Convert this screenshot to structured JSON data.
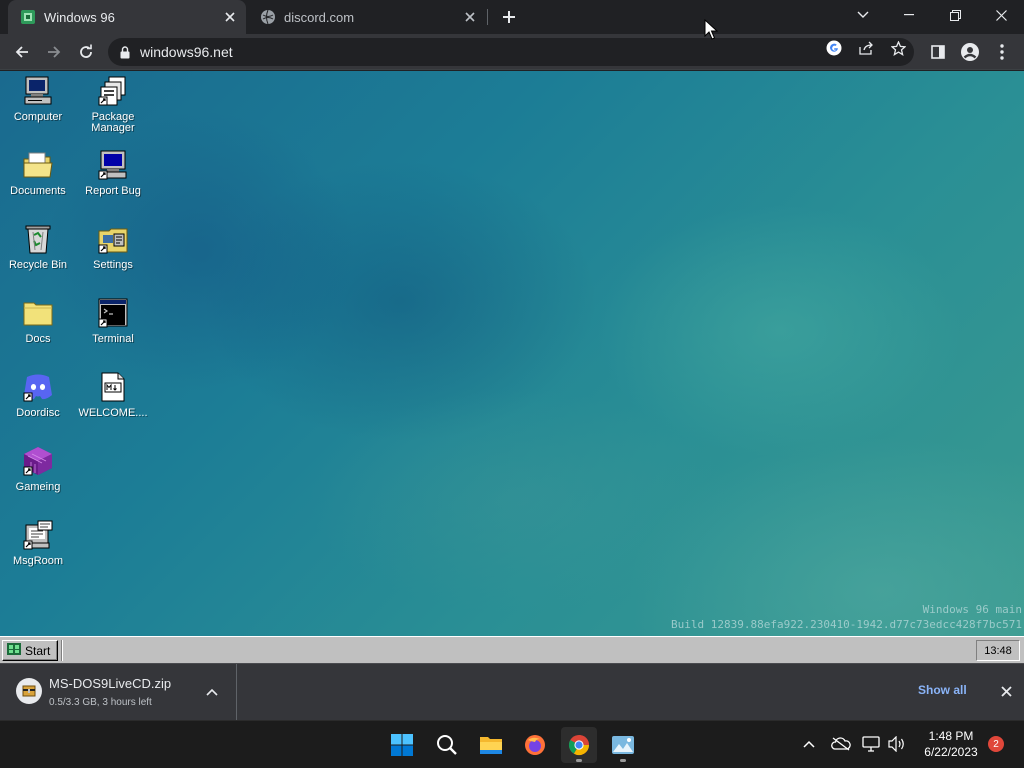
{
  "browser": {
    "tabs": [
      {
        "title": "Windows 96",
        "active": true,
        "favicon": "windows96-icon"
      },
      {
        "title": "discord.com",
        "active": false,
        "favicon": "globe-icon"
      }
    ],
    "url": "windows96.net"
  },
  "desktop": {
    "icons": [
      {
        "label": "Computer",
        "icon": "computer-icon"
      },
      {
        "label": "Package Manager",
        "icon": "package-manager-icon"
      },
      {
        "label": "Documents",
        "icon": "documents-folder-icon"
      },
      {
        "label": "Report Bug",
        "icon": "report-bug-icon"
      },
      {
        "label": "Recycle Bin",
        "icon": "recycle-bin-icon"
      },
      {
        "label": "Settings",
        "icon": "settings-icon"
      },
      {
        "label": "Docs",
        "icon": "folder-icon"
      },
      {
        "label": "Terminal",
        "icon": "terminal-icon"
      },
      {
        "label": "Doordisc",
        "icon": "doordisc-icon"
      },
      {
        "label": "WELCOME....",
        "icon": "markdown-file-icon"
      },
      {
        "label": "Gameing",
        "icon": "gameing-icon"
      },
      {
        "label": "MsgRoom",
        "icon": "msgroom-icon"
      }
    ],
    "build_line1": "Windows 96 main",
    "build_line2": "Build 12839.88efa922.230410-1942.d77c73edcc428f7bc571"
  },
  "w96_taskbar": {
    "start_label": "Start",
    "clock": "13:48"
  },
  "download_shelf": {
    "filename": "MS-DOS9LiveCD.zip",
    "status": "0.5/3.3 GB, 3 hours left",
    "show_all": "Show all"
  },
  "os_taskbar": {
    "time": "1:48 PM",
    "date": "6/22/2023",
    "notification_count": "2"
  },
  "colors": {
    "chrome_dark": "#202124",
    "chrome_toolbar": "#35363a",
    "link_blue": "#8ab4f8",
    "win96_gray": "#c0c0c0",
    "notif_red": "#e0473a"
  }
}
